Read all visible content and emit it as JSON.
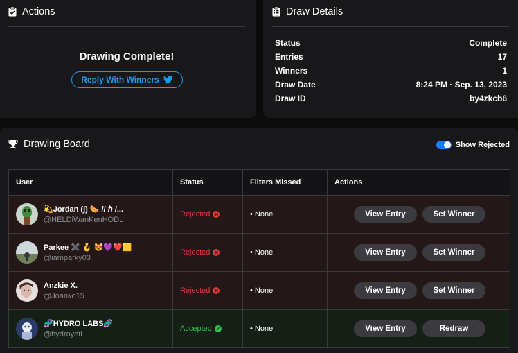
{
  "actions": {
    "title": "Actions",
    "complete_text": "Drawing Complete!",
    "reply_label": "Reply With Winners"
  },
  "details": {
    "title": "Draw Details",
    "rows": [
      {
        "label": "Status",
        "value": "Complete"
      },
      {
        "label": "Entries",
        "value": "17"
      },
      {
        "label": "Winners",
        "value": "1"
      },
      {
        "label": "Draw Date",
        "value": "8:24 PM · Sep. 13, 2023"
      },
      {
        "label": "Draw ID",
        "value": "by4zkcb6"
      }
    ]
  },
  "board": {
    "title": "Drawing Board",
    "toggle_label": "Show Rejected",
    "show_rejected": true,
    "columns": [
      "User",
      "Status",
      "Filters Missed",
      "Actions"
    ],
    "rows": [
      {
        "name": "💫Jordan (j) 🌭 // ℏ /...",
        "handle": "@HELDiWanKenHODL",
        "status": "Rejected",
        "filters": "• None",
        "btn1": "View Entry",
        "btn2": "Set Winner"
      },
      {
        "name": "Parkee ✖️ 🪝 😻💜❤️🟨",
        "handle": "@iamparky03",
        "status": "Rejected",
        "filters": "• None",
        "btn1": "View Entry",
        "btn2": "Set Winner"
      },
      {
        "name": "Anzkie X.",
        "handle": "@Joanko15",
        "status": "Rejected",
        "filters": "• None",
        "btn1": "View Entry",
        "btn2": "Set Winner"
      },
      {
        "name": "🧬HYDRO LABS🧬",
        "handle": "@hydroyeti",
        "status": "Accepted",
        "filters": "• None",
        "btn1": "View Entry",
        "btn2": "Redraw"
      }
    ]
  },
  "colors": {
    "accent": "#1d9bf0",
    "rejected": "#e03b3b",
    "accepted": "#2ec24b"
  }
}
